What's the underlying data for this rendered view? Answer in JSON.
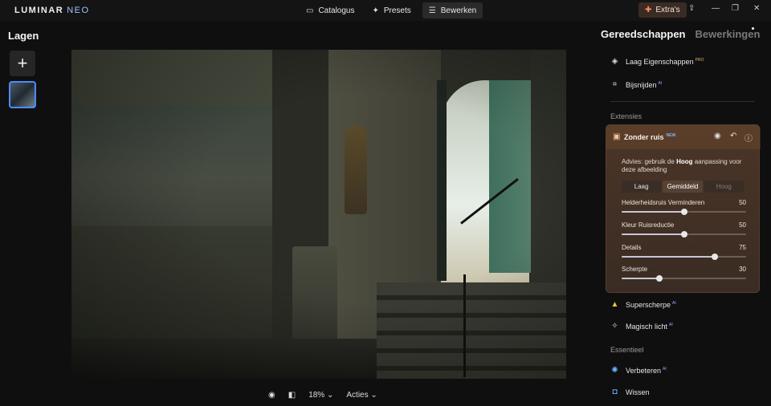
{
  "app": {
    "logo_main": "LUMINAR",
    "logo_sub": "NEO"
  },
  "nav": {
    "tabs": [
      {
        "label": "Catalogus",
        "icon": "folder-icon"
      },
      {
        "label": "Presets",
        "icon": "presets-icon"
      },
      {
        "label": "Bewerken",
        "icon": "sliders-icon",
        "active": true
      }
    ],
    "extras_label": "Extra's"
  },
  "left_panel": {
    "title": "Lagen",
    "add_label": "+"
  },
  "bottom_bar": {
    "zoom": "18%",
    "actions_label": "Acties"
  },
  "right_panel": {
    "tabs": {
      "tools": "Gereedschappen",
      "edits": "Bewerkingen"
    },
    "top_tools": [
      {
        "label": "Laag Eigenschappen",
        "badge": "PRO"
      },
      {
        "label": "Bijsnijden",
        "badge": "AI"
      }
    ],
    "section_extensions": "Extensies",
    "noise": {
      "title": "Zonder ruis",
      "badge": "NEW",
      "advice_pre": "Advies: gebruik de",
      "advice_bold": "Hoog",
      "advice_post": "aanpassing voor deze afbeelding",
      "modes": [
        "Laag",
        "Gemiddeld",
        "Hoog"
      ],
      "sliders": [
        {
          "label": "Helderheidsruis Verminderen",
          "value": 50
        },
        {
          "label": "Kleur Ruisreductie",
          "value": 50
        },
        {
          "label": "Details",
          "value": 75
        },
        {
          "label": "Scherpte",
          "value": 30
        }
      ]
    },
    "more_tools": [
      {
        "label": "Superscherpe",
        "badge": "AI"
      },
      {
        "label": "Magisch licht",
        "badge": "AI"
      }
    ],
    "section_essentials": "Essentieel",
    "essentials": [
      {
        "label": "Verbeteren",
        "badge": "AI"
      },
      {
        "label": "Wissen",
        "badge": ""
      }
    ]
  }
}
